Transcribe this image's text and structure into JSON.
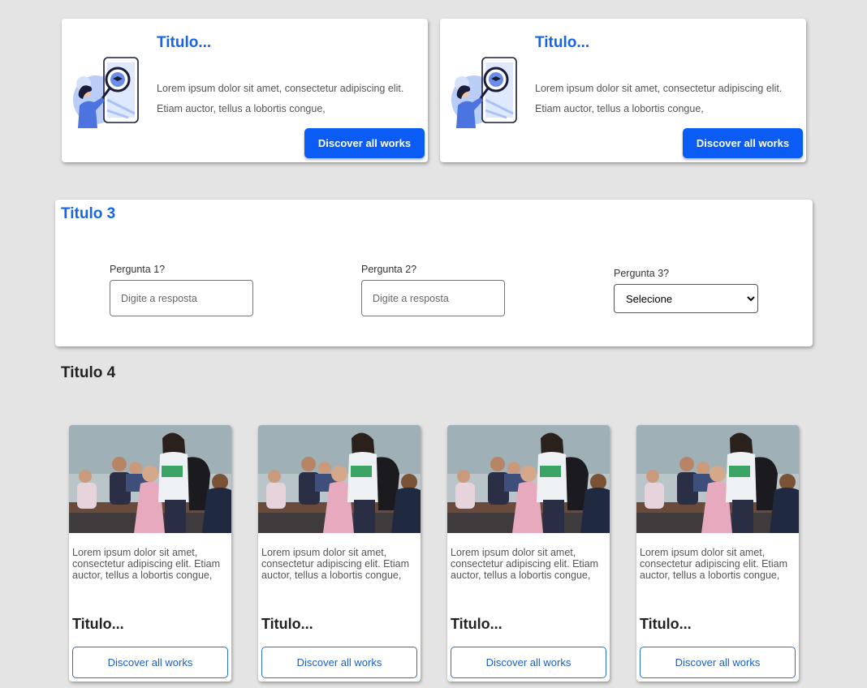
{
  "info_cards": [
    {
      "title": "Titulo...",
      "description_line1": "Lorem ipsum dolor sit amet, consectetur adipiscing elit.",
      "description_line2": "Etiam auctor, tellus a lobortis congue,",
      "button_label": "Discover all works"
    },
    {
      "title": "Titulo...",
      "description_line1": "Lorem ipsum dolor sit amet, consectetur adipiscing elit.",
      "description_line2": "Etiam auctor, tellus a lobortis congue,",
      "button_label": "Discover all works"
    }
  ],
  "form_section": {
    "title": "Titulo 3",
    "questions": [
      {
        "label": "Pergunta 1?",
        "placeholder": "Digite a resposta"
      },
      {
        "label": "Pergunta 2?",
        "placeholder": "Digite a resposta"
      },
      {
        "label": "Pergunta 3?",
        "selected": "Selecione"
      }
    ]
  },
  "section4": {
    "title": "Titulo 4",
    "cards": [
      {
        "description": "Lorem ipsum dolor sit amet, consectetur adipiscing elit. Etiam auctor, tellus a lobortis congue,",
        "title": "Titulo...",
        "button_label": "Discover all works"
      },
      {
        "description": "Lorem ipsum dolor sit amet, consectetur adipiscing elit. Etiam auctor, tellus a lobortis congue,",
        "title": "Titulo...",
        "button_label": "Discover all works"
      },
      {
        "description": "Lorem ipsum dolor sit amet, consectetur adipiscing elit. Etiam auctor, tellus a lobortis congue,",
        "title": "Titulo...",
        "button_label": "Discover all works"
      },
      {
        "description": "Lorem ipsum dolor sit amet, consectetur adipiscing elit. Etiam auctor, tellus a lobortis congue,",
        "title": "Titulo...",
        "button_label": "Discover all works"
      }
    ]
  },
  "colors": {
    "background": "#e4e4e4",
    "accent_blue": "#1565e8",
    "button_blue": "#0a5cf5",
    "text_dark": "#222222",
    "text_muted": "#555555"
  },
  "icons": {
    "illustration": "student-phone-search-illustration",
    "photo": "classroom-students-photo",
    "select_arrow": "chevron-down-icon"
  }
}
